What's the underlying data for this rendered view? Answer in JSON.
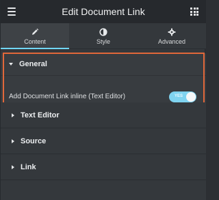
{
  "header": {
    "title": "Edit Document Link"
  },
  "tabs": [
    {
      "label": "Content",
      "active": true
    },
    {
      "label": "Style",
      "active": false
    },
    {
      "label": "Advanced",
      "active": false
    }
  ],
  "sections": {
    "general": {
      "title": "General",
      "control_label": "Add Document Link inline (Text Editor)",
      "toggle_state_text": "YES",
      "toggle_on": true
    },
    "text_editor": {
      "title": "Text Editor"
    },
    "source": {
      "title": "Source"
    },
    "link": {
      "title": "Link"
    }
  },
  "colors": {
    "accent": "#71d7f7",
    "toggle_on": "#7fd3f0",
    "highlight_border": "#e2683a",
    "header_bg": "#26292d",
    "panel_bg": "#34383c"
  }
}
